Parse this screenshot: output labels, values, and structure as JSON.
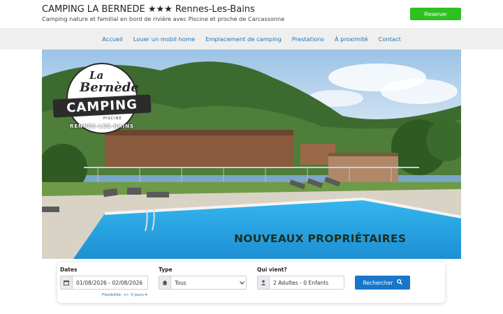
{
  "header": {
    "title": "CAMPING LA BERNEDE ★★★ Rennes-Les-Bains",
    "subtitle": "Camping nature et familial en bord de rivière avec Piscine et proche de Carcassonne",
    "reserve_label": "Reserver"
  },
  "nav": {
    "items": [
      {
        "label": "Accueil"
      },
      {
        "label": "Louer un mobil home"
      },
      {
        "label": "Emplacement de camping"
      },
      {
        "label": "Prestations"
      },
      {
        "label": "À proximité"
      },
      {
        "label": "Contact"
      }
    ]
  },
  "hero": {
    "logo_la": "La",
    "logo_bernede": "Bernède",
    "logo_camping": "CAMPING",
    "logo_piscine": "PISCINE",
    "logo_town": "RENNES-LES-BAINS",
    "banner": "NOUVEAUX PROPRIÉTAIRES"
  },
  "search": {
    "dates_label": "Dates",
    "dates_value": "01/08/2026 - 02/08/2026",
    "flex_text": "Flexibilité: +/- 3 jours",
    "type_label": "Type",
    "type_value": "Tous",
    "who_label": "Qui vient?",
    "who_value": "2 Adultes - 0 Enfants",
    "button_label": "Rechercher"
  },
  "colors": {
    "reserve": "#2fbf1f",
    "nav_link": "#1a73b5",
    "search_button": "#1877c9",
    "nav_bg": "#efefef"
  },
  "icons": {
    "calendar": "calendar-icon",
    "home": "home-icon",
    "user": "user-icon",
    "search": "search-icon",
    "dropdown": "chevron-down-icon"
  }
}
